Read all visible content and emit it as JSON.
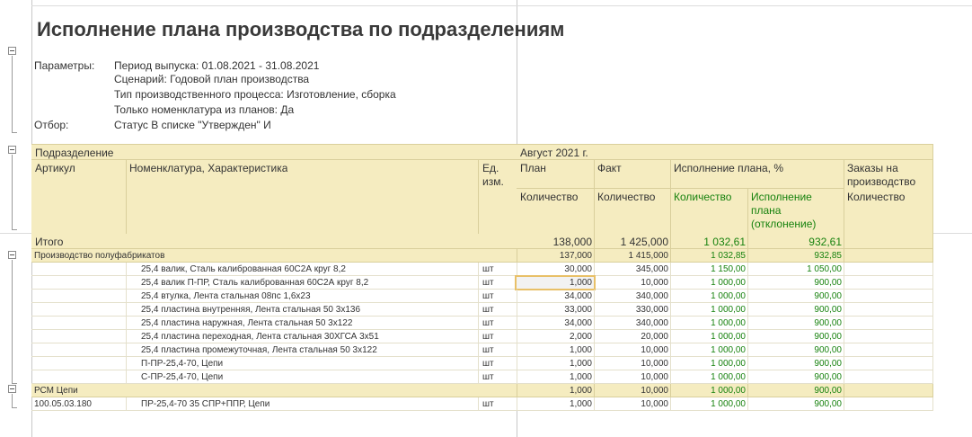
{
  "report": {
    "title": "Исполнение плана производства по подразделениям",
    "params": {
      "label_params": "Параметры:",
      "period": "Период выпуска: 01.08.2021 - 31.08.2021",
      "scenario": "Сценарий: Годовой план производства",
      "process_type": "Тип производственного процесса: Изготовление, сборка",
      "only_plans": "Только номенклатура из планов: Да",
      "label_filter": "Отбор:",
      "filter": "Статус В списке \"Утвержден\" И"
    }
  },
  "table": {
    "header": {
      "division": "Подразделение",
      "article": "Артикул",
      "nomenclature": "Номенклатура, Характеристика",
      "unit": "Ед. изм.",
      "month": "Август 2021 г.",
      "plan": "План",
      "fact": "Факт",
      "execution": "Исполнение плана, %",
      "orders": "Заказы на производство",
      "qty_plan": "Количество",
      "qty_fact": "Количество",
      "qty_exec": "Количество",
      "exec_deviation": "Исполнение плана (отклонение)",
      "qty_orders": "Количество"
    },
    "total": {
      "label": "Итого",
      "plan": "138,000",
      "fact": "1 425,000",
      "exec": "1 032,61",
      "dev": "932,61"
    },
    "groups": [
      {
        "name": "Производство полуфабрикатов",
        "plan": "137,000",
        "fact": "1 415,000",
        "exec": "1 032,85",
        "dev": "932,85",
        "rows": [
          {
            "article": "",
            "name": "25,4 валик, Сталь калиброванная 60С2А круг 8,2",
            "unit": "шт",
            "plan": "30,000",
            "fact": "345,000",
            "exec": "1 150,00",
            "dev": "1 050,00"
          },
          {
            "article": "",
            "name": "25,4 валик П-ПР, Сталь калиброванная 60С2А круг 8,2",
            "unit": "шт",
            "plan": "1,000",
            "fact": "10,000",
            "exec": "1 000,00",
            "dev": "900,00"
          },
          {
            "article": "",
            "name": "25,4 втулка, Лента стальная 08пс 1,6х23",
            "unit": "шт",
            "plan": "34,000",
            "fact": "340,000",
            "exec": "1 000,00",
            "dev": "900,00"
          },
          {
            "article": "",
            "name": "25,4 пластина внутренняя, Лента стальная 50 3х136",
            "unit": "шт",
            "plan": "33,000",
            "fact": "330,000",
            "exec": "1 000,00",
            "dev": "900,00"
          },
          {
            "article": "",
            "name": "25,4 пластина наружная, Лента стальная 50 3х122",
            "unit": "шт",
            "plan": "34,000",
            "fact": "340,000",
            "exec": "1 000,00",
            "dev": "900,00"
          },
          {
            "article": "",
            "name": "25,4 пластина переходная, Лента стальная 30ХГСА 3х51",
            "unit": "шт",
            "plan": "2,000",
            "fact": "20,000",
            "exec": "1 000,00",
            "dev": "900,00"
          },
          {
            "article": "",
            "name": "25,4 пластина промежуточная, Лента стальная 50 3х122",
            "unit": "шт",
            "plan": "1,000",
            "fact": "10,000",
            "exec": "1 000,00",
            "dev": "900,00"
          },
          {
            "article": "",
            "name": "П-ПР-25,4-70, Цепи",
            "unit": "шт",
            "plan": "1,000",
            "fact": "10,000",
            "exec": "1 000,00",
            "dev": "900,00"
          },
          {
            "article": "",
            "name": "С-ПР-25,4-70, Цепи",
            "unit": "шт",
            "plan": "1,000",
            "fact": "10,000",
            "exec": "1 000,00",
            "dev": "900,00"
          }
        ]
      },
      {
        "name": "РСМ Цепи",
        "plan": "1,000",
        "fact": "10,000",
        "exec": "1 000,00",
        "dev": "900,00",
        "rows": [
          {
            "article": "100.05.03.180",
            "name": "ПР-25,4-70 35 СПР+ППР, Цепи",
            "unit": "шт",
            "plan": "1,000",
            "fact": "10,000",
            "exec": "1 000,00",
            "dev": "900,00"
          }
        ]
      }
    ]
  },
  "colors": {
    "header_bg": "#f5ecc0",
    "green_text": "#17820e",
    "selected_border": "#e8c068"
  }
}
